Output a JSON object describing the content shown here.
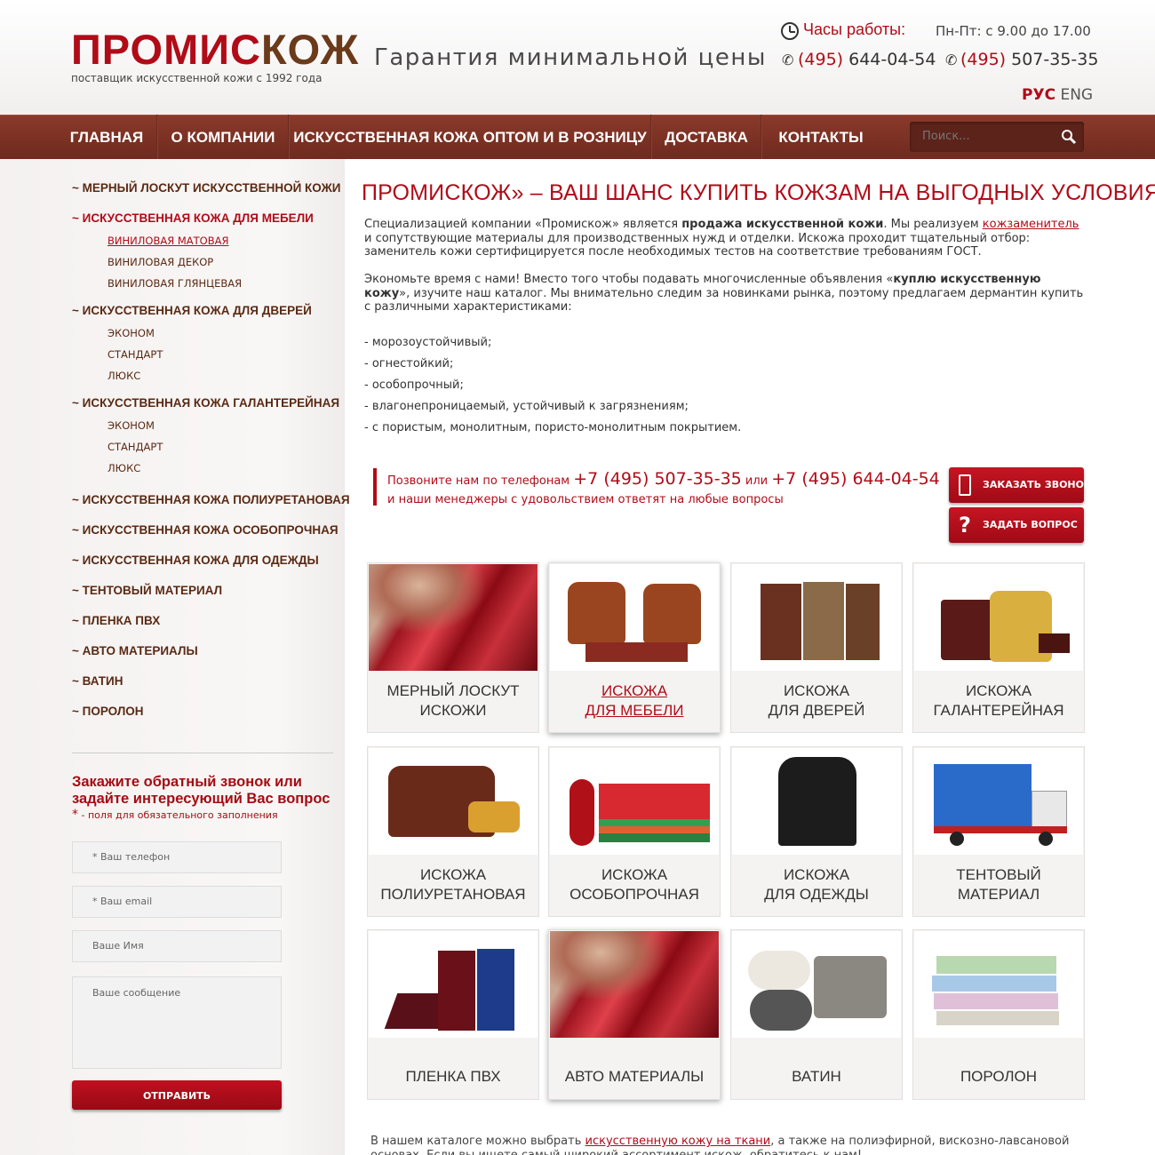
{
  "header": {
    "logo_red": "ПРОМИС",
    "logo_brown": "КОЖ",
    "logo_sub": "поставщик искусственной кожи с 1992 года",
    "slogan": "Гарантия минимальной цены",
    "hours_label": "Часы работы:",
    "hours_value": "Пн-Пт: с 9.00 до 17.00",
    "phone1_code": "(495)",
    "phone1_num": " 644-04-54",
    "phone2_code": "(495)",
    "phone2_num": " 507-35-35",
    "lang_ru": "РУС",
    "lang_en": "ENG"
  },
  "nav": {
    "items": [
      "ГЛАВНАЯ",
      "О КОМПАНИИ",
      "ИСКУССТВЕННАЯ КОЖА ОПТОМ И В РОЗНИЦУ",
      "ДОСТАВКА",
      "КОНТАКТЫ"
    ],
    "search_placeholder": "Поиск..."
  },
  "sidebar": {
    "items": [
      "~ МЕРНЫЙ ЛОСКУТ ИСКУССТВЕННОЙ КОЖИ",
      "~ ИСКУССТВЕННАЯ КОЖА ДЛЯ МЕБЕЛИ",
      "~ ИСКУССТВЕННАЯ КОЖА ДЛЯ ДВЕРЕЙ",
      "~ ИСКУССТВЕННАЯ КОЖА ГАЛАНТЕРЕЙНАЯ",
      "~  ИСКУССТВЕННАЯ КОЖА ПОЛИУРЕТАНОВАЯ",
      "~  ИСКУССТВЕННАЯ КОЖА ОСОБОПРОЧНАЯ",
      "~  ИСКУССТВЕННАЯ КОЖА ДЛЯ ОДЕЖДЫ",
      "~  ТЕНТОВЫЙ МАТЕРИАЛ",
      "~  ПЛЕНКА ПВХ",
      "~  АВТО МАТЕРИАЛЫ",
      "~  ВАТИН",
      "~  ПОРОЛОН"
    ],
    "furniture_subs": [
      "ВИНИЛОВАЯ МАТОВАЯ",
      "ВИНИЛОВАЯ ДЕКОР",
      "ВИНИЛОВАЯ ГЛЯНЦЕВАЯ"
    ],
    "doors_subs": [
      "ЭКОНОМ",
      "СТАНДАРТ",
      "ЛЮКС"
    ],
    "haber_subs": [
      "ЭКОНОМ",
      "СТАНДАРТ",
      "ЛЮКС"
    ]
  },
  "form": {
    "title": "Закажите обратный звонок или задайте интересующий Вас вопрос",
    "req_star": "*",
    "req_text": " - поля для обязательного заполнения",
    "phone_placeholder": "* Ваш телефон",
    "email_placeholder": "* Ваш email",
    "name_placeholder": "Ваше Имя",
    "message_placeholder": "Ваше сообщение",
    "submit": "ОТПРАВИТЬ"
  },
  "main": {
    "title": "ПРОМИСКОЖ» – ВАШ ШАНС КУПИТЬ КОЖЗАМ НА ВЫГОДНЫХ УСЛОВИЯХ",
    "p1_a": "Специализацией компании «Промискож» является ",
    "p1_b": "продажа искусственной кожи",
    "p1_c": ". Мы реализуем ",
    "p1_link": "кожзаменитель",
    "p1_d": " и сопутствующие материалы для производственных нужд и отделки. Искожа проходит тщательный отбор: заменитель кожи сертифицируется после необходимых тестов на соответствие требованиям ГОСТ.",
    "p2_a": "Экономьте время с нами! Вместо того чтобы подавать многочисленные объявления «",
    "p2_b": "куплю искусственную кожу",
    "p2_c": "», изучите наш каталог. Мы внимательно следим за новинками рынка, поэтому предлагаем дермантин купить с различными характеристиками:",
    "list": [
      "- морозоустойчивый;",
      "- огнестойкий;",
      "- особопрочный;",
      "- влагонепроницаемый, устойчивый к загрязнениям;",
      "- с пористым, монолитным, пористо-монолитным покрытием."
    ],
    "call_prefix": "Позвоните нам по телефонам ",
    "call_phone1": "+7 (495) 507-35-35",
    "call_or": " или ",
    "call_phone2": "+7 (495) 644-04-54",
    "call_line2": "и наши менеджеры с удовольствием ответят на любые вопросы",
    "btn_call": "ЗАКАЗАТЬ ЗВОНОК",
    "btn_question": "ЗАДАТЬ ВОПРОС",
    "bottom_a": "В нашем каталоге можно выбрать ",
    "bottom_link": "искусственную кожу на ткани",
    "bottom_b": ", а также на полиэфирной, вискозно-лавсановой основах. Если вы ищете самый широкий ассортимент искож, обратитесь к нам!"
  },
  "cards": [
    {
      "l1": "МЕРНЫЙ ЛОСКУТ",
      "l2": "ИСКОЖИ",
      "img": "leather-photo"
    },
    {
      "l1": "ИСКОЖА",
      "l2": "ДЛЯ МЕБЕЛИ",
      "img": "armchairs-photo"
    },
    {
      "l1": "ИСКОЖА",
      "l2": "ДЛЯ ДВЕРЕЙ",
      "img": "doors-photo"
    },
    {
      "l1": "ИСКОЖА",
      "l2": "ГАЛАНТЕРЕЙНАЯ",
      "img": "bags-photo"
    },
    {
      "l1": "ИСКОЖА",
      "l2": "ПОЛИУРЕТАНОВАЯ",
      "img": "sofa-photo"
    },
    {
      "l1": "ИСКОЖА",
      "l2": "ОСОБОПРОЧНАЯ",
      "img": "mats-photo"
    },
    {
      "l1": "ИСКОЖА",
      "l2": "ДЛЯ ОДЕЖДЫ",
      "img": "jacket-photo"
    },
    {
      "l1": "ТЕНТОВЫЙ",
      "l2": "МАТЕРИАЛ",
      "img": "truck-photo"
    },
    {
      "l1": "ПЛЕНКА ПВХ",
      "l2": "",
      "img": "binders-photo"
    },
    {
      "l1": "АВТО МАТЕРИАЛЫ",
      "l2": "",
      "img": "leather-photo"
    },
    {
      "l1": "ВАТИН",
      "l2": "",
      "img": "rolls-photo"
    },
    {
      "l1": "ПОРОЛОН",
      "l2": "",
      "img": "foam-photo"
    }
  ],
  "colors": {
    "accent": "#b00c18",
    "nav": "#7a3022",
    "brown": "#5a2a14"
  }
}
